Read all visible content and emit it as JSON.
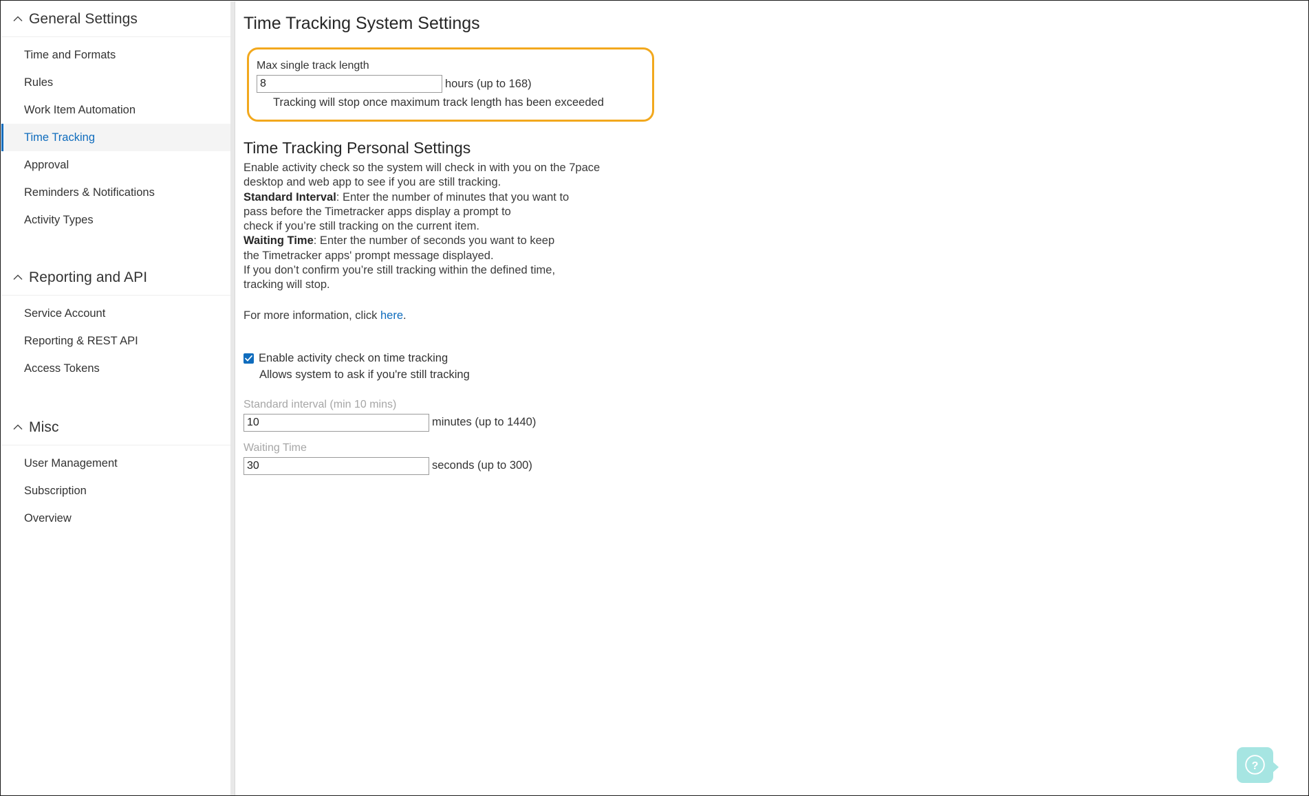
{
  "sidebar": {
    "groups": [
      {
        "title": "General Settings",
        "icon": "chevron-up-icon",
        "items": [
          {
            "label": "Time and Formats",
            "selected": false
          },
          {
            "label": "Rules",
            "selected": false
          },
          {
            "label": "Work Item Automation",
            "selected": false
          },
          {
            "label": "Time Tracking",
            "selected": true
          },
          {
            "label": "Approval",
            "selected": false
          },
          {
            "label": "Reminders & Notifications",
            "selected": false
          },
          {
            "label": "Activity Types",
            "selected": false
          }
        ]
      },
      {
        "title": "Reporting and API",
        "icon": "chevron-up-icon",
        "items": [
          {
            "label": "Service Account",
            "selected": false
          },
          {
            "label": "Reporting & REST API",
            "selected": false
          },
          {
            "label": "Access Tokens",
            "selected": false
          }
        ]
      },
      {
        "title": "Misc",
        "icon": "chevron-up-icon",
        "items": [
          {
            "label": "User Management",
            "selected": false
          },
          {
            "label": "Subscription",
            "selected": false
          },
          {
            "label": "Overview",
            "selected": false
          }
        ]
      }
    ]
  },
  "main": {
    "system_settings": {
      "heading": "Time Tracking System Settings",
      "max_track": {
        "label": "Max single track length",
        "value": "8",
        "unit": "hours (up to 168)",
        "hint": "Tracking will stop once maximum track length has been exceeded"
      },
      "highlight_color": "#f2a81d"
    },
    "personal_settings": {
      "heading": "Time Tracking Personal Settings",
      "paragraph_lines": [
        "Enable activity check so the system will check in with you on the 7pace",
        "desktop and web app to see if you are still tracking."
      ],
      "standard_interval_bold": "Standard Interval",
      "standard_interval_lines": [
        ": Enter the number of minutes that you want to",
        "pass before the Timetracker apps display a prompt to",
        "check if you’re still tracking on the current item."
      ],
      "waiting_time_bold": "Waiting Time",
      "waiting_time_lines": [
        ": Enter the number of seconds you want to keep",
        "the Timetracker apps' prompt message displayed.",
        "If you don’t confirm you’re still tracking within the defined time,",
        "tracking will stop."
      ],
      "more_info_prefix": "For more information, click ",
      "more_info_link": "here",
      "more_info_suffix": ".",
      "checkbox": {
        "label": "Enable activity check on time tracking",
        "sublabel": "Allows system to ask if you're still tracking",
        "checked": true,
        "accent": "#0f6cbd"
      },
      "standard_interval_field": {
        "label": "Standard interval (min 10 mins)",
        "value": "10",
        "unit": "minutes (up to 1440)"
      },
      "waiting_time_field": {
        "label": "Waiting Time",
        "value": "30",
        "unit": "seconds (up to 300)"
      }
    }
  },
  "help_widget": {
    "icon": "question-mark-icon",
    "color": "#a6e5e2"
  }
}
